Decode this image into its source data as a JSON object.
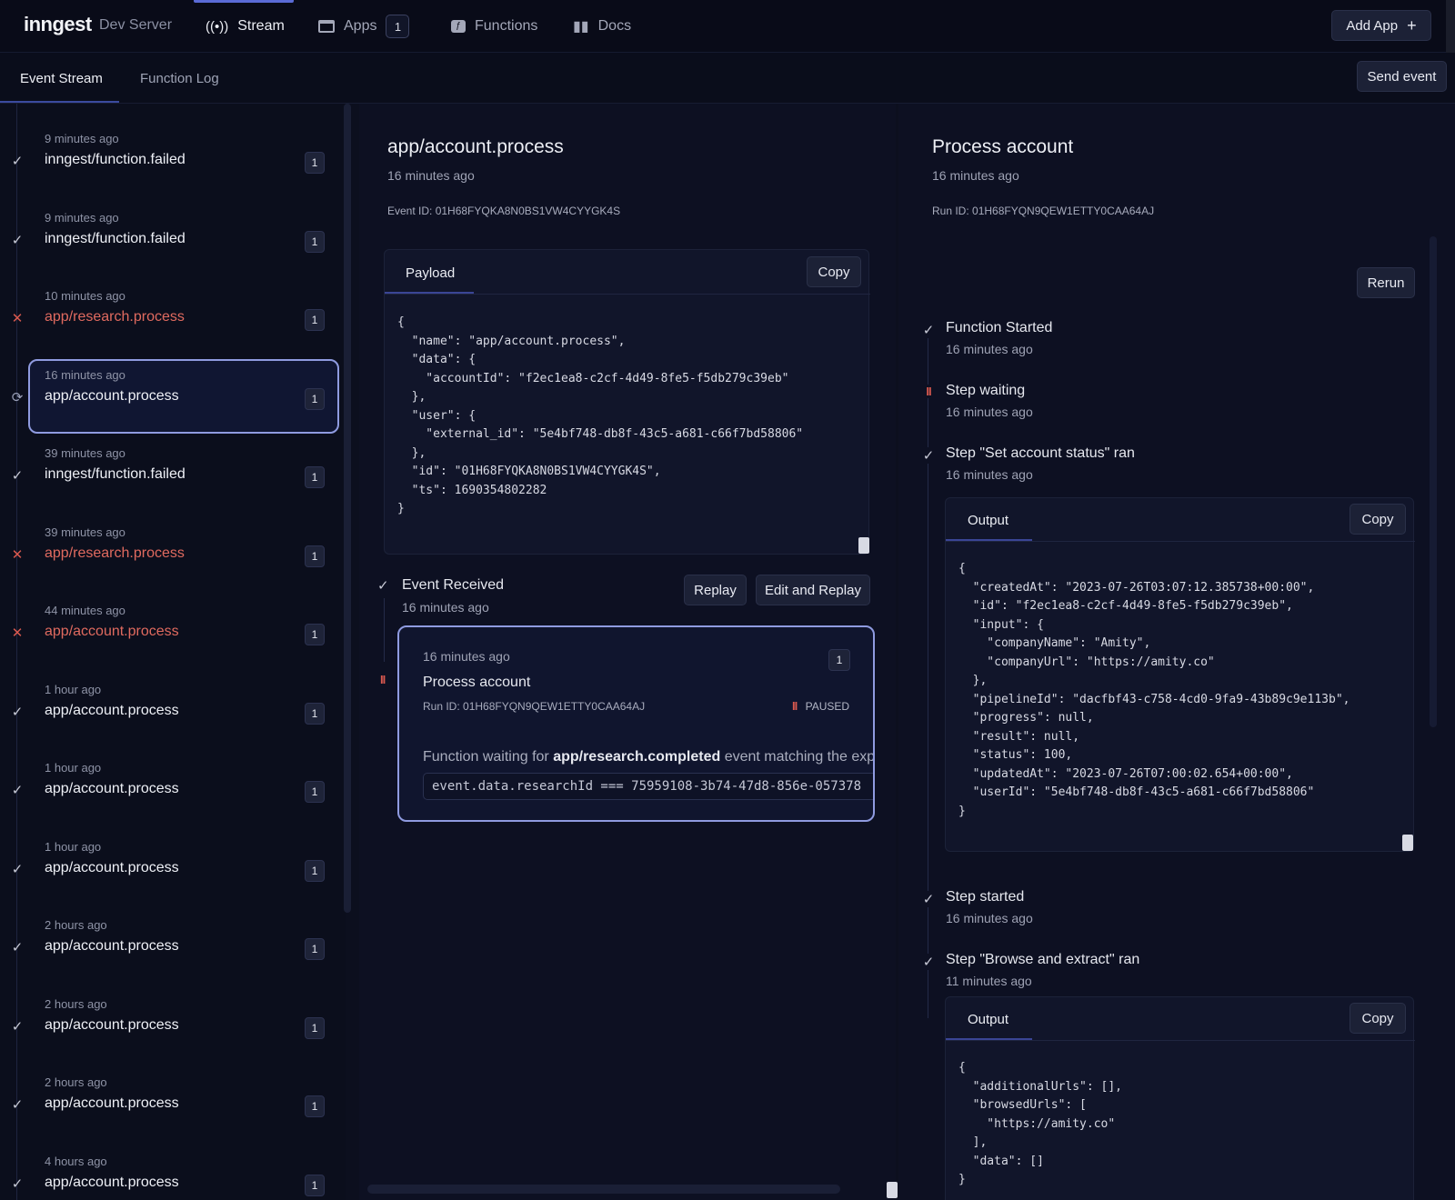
{
  "app": {
    "logo": "inngest",
    "subtitle": "Dev Server"
  },
  "nav": {
    "stream": "Stream",
    "apps": "Apps",
    "apps_count": "1",
    "functions": "Functions",
    "docs": "Docs",
    "add_app": "Add App",
    "add_app_icon": "+"
  },
  "subtabs": {
    "event_stream": "Event Stream",
    "function_log": "Function Log",
    "send_event": "Send event"
  },
  "events": [
    {
      "time": "9 minutes ago",
      "name": "inngest/function.failed",
      "status": "ok",
      "count": "1"
    },
    {
      "time": "9 minutes ago",
      "name": "inngest/function.failed",
      "status": "ok",
      "count": "1"
    },
    {
      "time": "10 minutes ago",
      "name": "app/research.process",
      "status": "fail",
      "count": "1"
    },
    {
      "time": "16 minutes ago",
      "name": "app/account.process",
      "status": "run",
      "count": "1"
    },
    {
      "time": "39 minutes ago",
      "name": "inngest/function.failed",
      "status": "ok",
      "count": "1"
    },
    {
      "time": "39 minutes ago",
      "name": "app/research.process",
      "status": "fail",
      "count": "1"
    },
    {
      "time": "44 minutes ago",
      "name": "app/account.process",
      "status": "fail",
      "count": "1"
    },
    {
      "time": "1 hour ago",
      "name": "app/account.process",
      "status": "ok",
      "count": "1"
    },
    {
      "time": "1 hour ago",
      "name": "app/account.process",
      "status": "ok",
      "count": "1"
    },
    {
      "time": "1 hour ago",
      "name": "app/account.process",
      "status": "ok",
      "count": "1"
    },
    {
      "time": "2 hours ago",
      "name": "app/account.process",
      "status": "ok",
      "count": "1"
    },
    {
      "time": "2 hours ago",
      "name": "app/account.process",
      "status": "ok",
      "count": "1"
    },
    {
      "time": "2 hours ago",
      "name": "app/account.process",
      "status": "ok",
      "count": "1"
    },
    {
      "time": "4 hours ago",
      "name": "app/account.process",
      "status": "ok",
      "count": "1"
    }
  ],
  "event_detail": {
    "title": "app/account.process",
    "time": "16 minutes ago",
    "event_id": "Event ID: 01H68FYQKA8N0BS1VW4CYYGK4S",
    "payload_tab": "Payload",
    "copy": "Copy",
    "payload": "{\n  \"name\": \"app/account.process\",\n  \"data\": {\n    \"accountId\": \"f2ec1ea8-c2cf-4d49-8fe5-f5db279c39eb\"\n  },\n  \"user\": {\n    \"external_id\": \"5e4bf748-db8f-43c5-a681-c66f7bd58806\"\n  },\n  \"id\": \"01H68FYQKA8N0BS1VW4CYYGK4S\",\n  \"ts\": 1690354802282\n}",
    "received_label": "Event Received",
    "received_time": "16 minutes ago",
    "replay": "Replay",
    "edit_replay": "Edit and Replay",
    "run_card": {
      "time": "16 minutes ago",
      "count": "1",
      "name": "Process account",
      "run_id": "Run ID: 01H68FYQN9QEW1ETTY0CAA64AJ",
      "status": "PAUSED",
      "waiting_prefix": "Function waiting for ",
      "waiting_event": "app/research.completed",
      "waiting_suffix": " event matching the expre",
      "expression": "event.data.researchId === 75959108-3b74-47d8-856e-057378"
    }
  },
  "run_detail": {
    "title": "Process account",
    "time": "16 minutes ago",
    "run_id": "Run ID: 01H68FYQN9QEW1ETTY0CAA64AJ",
    "rerun": "Rerun",
    "steps": [
      {
        "label": "Function Started",
        "time": "16 minutes ago",
        "icon": "check"
      },
      {
        "label": "Step waiting",
        "time": "16 minutes ago",
        "icon": "pause"
      },
      {
        "label": "Step \"Set account status\" ran",
        "time": "16 minutes ago",
        "icon": "check"
      },
      {
        "label": "Step started",
        "time": "16 minutes ago",
        "icon": "check"
      },
      {
        "label": "Step \"Browse and extract\" ran",
        "time": "11 minutes ago",
        "icon": "check"
      }
    ],
    "output_tab": "Output",
    "copy": "Copy",
    "output1": "{\n  \"createdAt\": \"2023-07-26T03:07:12.385738+00:00\",\n  \"id\": \"f2ec1ea8-c2cf-4d49-8fe5-f5db279c39eb\",\n  \"input\": {\n    \"companyName\": \"Amity\",\n    \"companyUrl\": \"https://amity.co\"\n  },\n  \"pipelineId\": \"dacfbf43-c758-4cd0-9fa9-43b89c9e113b\",\n  \"progress\": null,\n  \"result\": null,\n  \"status\": 100,\n  \"updatedAt\": \"2023-07-26T07:00:02.654+00:00\",\n  \"userId\": \"5e4bf748-db8f-43c5-a681-c66f7bd58806\"\n}",
    "output2": "{\n  \"additionalUrls\": [],\n  \"browsedUrls\": [\n    \"https://amity.co\"\n  ],\n  \"data\": []\n}"
  },
  "colors": {
    "background": "#0c0f1e",
    "accent": "#8f9be0",
    "error": "#e06a5f"
  }
}
